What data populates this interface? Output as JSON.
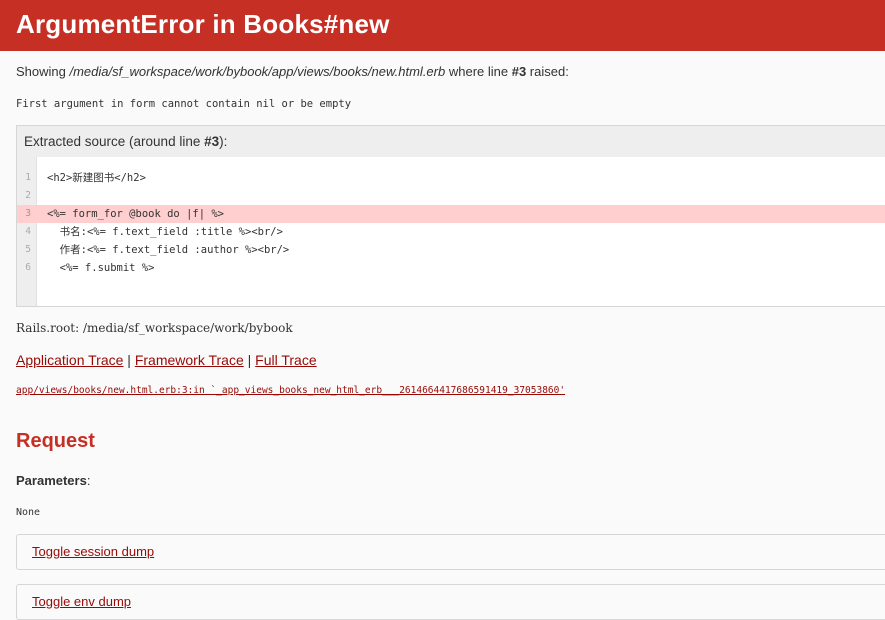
{
  "header": {
    "title": "ArgumentError in Books#new"
  },
  "showing": {
    "prefix": "Showing ",
    "path": "/media/sf_workspace/work/bybook/app/views/books/new.html.erb",
    "middle": " where line ",
    "line_ref": "#3",
    "suffix": " raised:"
  },
  "error_message": "First argument in form cannot contain nil or be empty",
  "source": {
    "heading_prefix": "Extracted source (around line ",
    "heading_line": "#3",
    "heading_suffix": "):",
    "lines": [
      {
        "num": "1",
        "code": "<h2>新建图书</h2>"
      },
      {
        "num": "2",
        "code": ""
      },
      {
        "num": "3",
        "code": "<%= form_for @book do |f| %>"
      },
      {
        "num": "4",
        "code": "  书名:<%= f.text_field :title %><br/>"
      },
      {
        "num": "5",
        "code": "  作者:<%= f.text_field :author %><br/>"
      },
      {
        "num": "6",
        "code": "  <%= f.submit %>"
      }
    ],
    "highlighted_line": "3"
  },
  "rails_root": "Rails.root: /media/sf_workspace/work/bybook",
  "traces": {
    "application": "Application Trace",
    "framework": "Framework Trace",
    "full": "Full Trace",
    "separator": " | "
  },
  "trace_line": "app/views/books/new.html.erb:3:in `_app_views_books_new_html_erb___2614664417686591419_37053860'",
  "request": {
    "title": "Request",
    "params_label": "Parameters",
    "params_colon": ":",
    "params_value": "None",
    "session_toggle": "Toggle session dump",
    "env_toggle": "Toggle env dump"
  },
  "colors": {
    "header_bg": "#c52f24",
    "link": "#980905",
    "highlight": "#ffcece"
  }
}
